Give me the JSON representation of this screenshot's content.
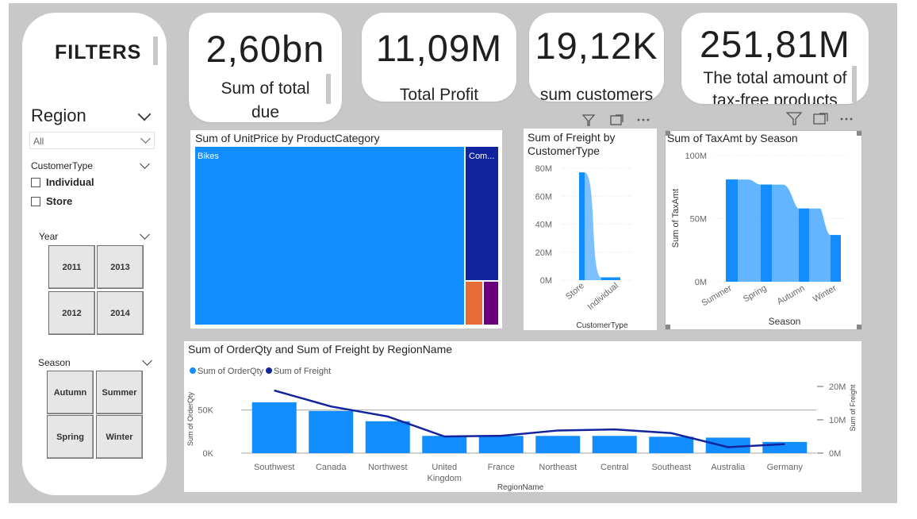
{
  "filters": {
    "title": "FILTERS",
    "region": {
      "label": "Region",
      "value": "All"
    },
    "customer_type": {
      "label": "CustomerType",
      "options": [
        "Individual",
        "Store"
      ]
    },
    "year": {
      "label": "Year",
      "tiles": [
        "2011",
        "2013",
        "2012",
        "2014"
      ]
    },
    "season": {
      "label": "Season",
      "tiles": [
        "Autumn",
        "Summer",
        "Spring",
        "Winter"
      ]
    }
  },
  "kpis": [
    {
      "value": "2,60bn",
      "label_line1": "Sum of total",
      "label_line2": "due"
    },
    {
      "value": "11,09M",
      "label_line1": "Total Profit"
    },
    {
      "value": "19,12K",
      "label_line1": "sum customers"
    },
    {
      "value": "251,81M",
      "label_line1": "The total amount of",
      "label_line2": "tax-free products"
    }
  ],
  "treemap": {
    "title": "Sum of UnitPrice by ProductCategory",
    "chart_data": {
      "type": "treemap",
      "categories": [
        "Bikes",
        "Com...",
        "",
        ""
      ],
      "colors": [
        "#118DFF",
        "#12239E",
        "#E66C37",
        "#6B007B"
      ]
    }
  },
  "freight_by_customer": {
    "title_line1": "Sum of Freight by",
    "title_line2": "CustomerType",
    "chart_data": {
      "type": "area",
      "categories": [
        "Store",
        "Individual"
      ],
      "values": [
        77000000,
        2000000
      ],
      "y_ticks": [
        "80M",
        "60M",
        "40M",
        "20M",
        "0M"
      ],
      "ylim": [
        0,
        80000000
      ],
      "xlabel": "CustomerType",
      "color": "#118DFF"
    }
  },
  "tax_by_season": {
    "title": "Sum of TaxAmt by Season",
    "chart_data": {
      "type": "area",
      "categories": [
        "Summer",
        "Spring",
        "Autumn",
        "Winter"
      ],
      "values": [
        81000000,
        77000000,
        58000000,
        37000000
      ],
      "y_ticks": [
        "100M",
        "50M",
        "0M"
      ],
      "ylim": [
        0,
        100000000
      ],
      "xlabel": "Season",
      "ylabel": "Sum of TaxAmt",
      "color": "#118DFF"
    }
  },
  "region_chart": {
    "title": "Sum of OrderQty and Sum of Freight by RegionName",
    "chart_data": {
      "type": "bar",
      "categories": [
        "Southwest",
        "Canada",
        "Northwest",
        "United Kingdom",
        "France",
        "Northeast",
        "Central",
        "Southeast",
        "Australia",
        "Germany"
      ],
      "category_lines": [
        [
          "Southwest"
        ],
        [
          "Canada"
        ],
        [
          "Northwest"
        ],
        [
          "United",
          "Kingdom"
        ],
        [
          "France"
        ],
        [
          "Northeast"
        ],
        [
          "Central"
        ],
        [
          "Southeast"
        ],
        [
          "Australia"
        ],
        [
          "Germany"
        ]
      ],
      "series": [
        {
          "name": "Sum of OrderQty",
          "type": "bar",
          "color": "#118DFF",
          "values": [
            59000,
            49000,
            37000,
            20000,
            20000,
            20000,
            20000,
            19000,
            18000,
            13000
          ]
        },
        {
          "name": "Sum of Freight",
          "type": "line",
          "color": "#12239E",
          "values": [
            18800000,
            14000000,
            11000000,
            5000000,
            5200000,
            6800000,
            7100000,
            6000000,
            1800000,
            2700000
          ]
        }
      ],
      "y_left_ticks": [
        "50K",
        "0K"
      ],
      "y_left_lim": [
        0,
        70000
      ],
      "y_right_ticks": [
        "20M",
        "10M",
        "0M"
      ],
      "y_right_lim": [
        0,
        20000000
      ],
      "xlabel": "RegionName",
      "ylabel_left": "Sum of OrderQty",
      "ylabel_right": "Sum of Freight"
    }
  }
}
